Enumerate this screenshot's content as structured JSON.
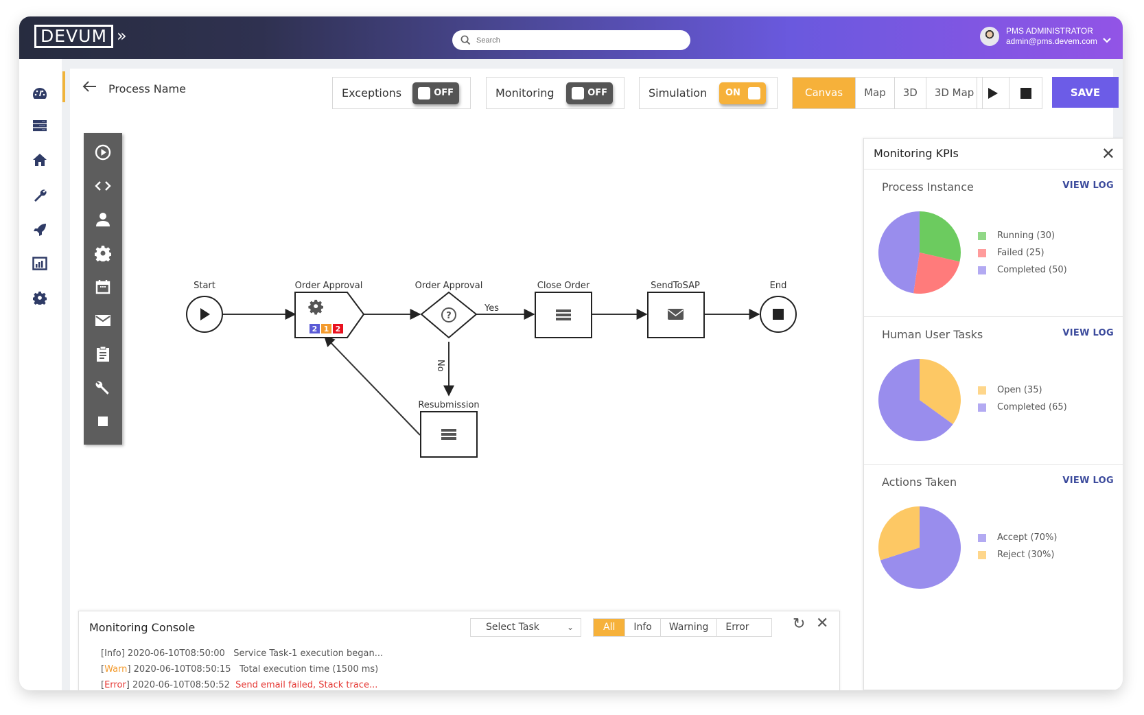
{
  "app": {
    "logo": "DEVUM",
    "search_placeholder": "Search",
    "user": {
      "name": "PMS ADMINISTRATOR",
      "email": "admin@pms.devem.com"
    }
  },
  "sidenav": {
    "items": [
      {
        "name": "dashboard",
        "icon": "speedometer-icon"
      },
      {
        "name": "servers",
        "icon": "server-icon"
      },
      {
        "name": "home",
        "icon": "home-icon"
      },
      {
        "name": "tools",
        "icon": "wrench-icon"
      },
      {
        "name": "deploy",
        "icon": "rocket-icon"
      },
      {
        "name": "reports",
        "icon": "bar-chart-icon"
      },
      {
        "name": "settings",
        "icon": "gear-icon"
      }
    ]
  },
  "toolbar": {
    "process_name": "Process Name",
    "toggles": [
      {
        "label": "Exceptions",
        "state": "OFF"
      },
      {
        "label": "Monitoring",
        "state": "OFF"
      },
      {
        "label": "Simulation",
        "state": "ON"
      }
    ],
    "view_tabs": [
      "Canvas",
      "Map",
      "3D",
      "3D Map"
    ],
    "active_view": "Canvas",
    "save_label": "SAVE"
  },
  "palette": {
    "tools": [
      "start-event",
      "script",
      "user-task",
      "service-task",
      "timer",
      "email",
      "form",
      "tool",
      "end-event"
    ]
  },
  "diagram": {
    "nodes": [
      {
        "id": "start",
        "label": "Start",
        "type": "start-event"
      },
      {
        "id": "order-approval-task",
        "label": "Order Approval",
        "type": "service-task",
        "badges": [
          {
            "value": "2",
            "color": "#5b5bd6"
          },
          {
            "value": "1",
            "color": "#f39a2d"
          },
          {
            "value": "2",
            "color": "#e8111f"
          }
        ]
      },
      {
        "id": "order-approval-gateway",
        "label": "Order Approval",
        "type": "gateway"
      },
      {
        "id": "close-order",
        "label": "Close Order",
        "type": "task"
      },
      {
        "id": "send-to-sap",
        "label": "SendToSAP",
        "type": "email-task"
      },
      {
        "id": "end",
        "label": "End",
        "type": "end-event"
      },
      {
        "id": "resubmission",
        "label": "Resubmission",
        "type": "task"
      }
    ],
    "edge_labels": {
      "yes": "Yes",
      "no": "No"
    }
  },
  "kpis": {
    "title": "Monitoring KPIs",
    "view_log_label": "VIEW LOG",
    "sections": [
      {
        "title": "Process Instance",
        "chart_type": "pie",
        "slices": [
          {
            "label": "Running (30)",
            "value": 30,
            "color": "#6ccb5f"
          },
          {
            "label": "Failed (25)",
            "value": 25,
            "color": "#ff7b7b"
          },
          {
            "label": "Completed (50)",
            "value": 50,
            "color": "#998ded"
          }
        ]
      },
      {
        "title": "Human User Tasks",
        "chart_type": "pie",
        "slices": [
          {
            "label": "Open (35)",
            "value": 35,
            "color": "#fdc864"
          },
          {
            "label": "Completed (65)",
            "value": 65,
            "color": "#998ded"
          }
        ]
      },
      {
        "title": "Actions Taken",
        "chart_type": "pie",
        "slices": [
          {
            "label": "Accept  (70%)",
            "value": 70,
            "color": "#998ded"
          },
          {
            "label": "Reject (30%)",
            "value": 30,
            "color": "#fdc864"
          }
        ]
      }
    ]
  },
  "console": {
    "title": "Monitoring Console",
    "select_task": "Select Task",
    "filters": [
      "All",
      "Info",
      "Warning",
      "Error"
    ],
    "active_filter": "All",
    "logs": [
      {
        "level": "Info",
        "timestamp": "2020-06-10T08:50:00",
        "message": "Service Task-1 execution began..."
      },
      {
        "level": "Warn",
        "timestamp": "2020-06-10T08:50:15",
        "message": "Total execution time (1500 ms)"
      },
      {
        "level": "Error",
        "timestamp": "2020-06-10T08:50:52",
        "message": "Send email failed, Stack trace..."
      }
    ]
  },
  "colors": {
    "accent": "#f6b13a",
    "primary": "#6c5ce7",
    "link": "#3b4a9c"
  }
}
